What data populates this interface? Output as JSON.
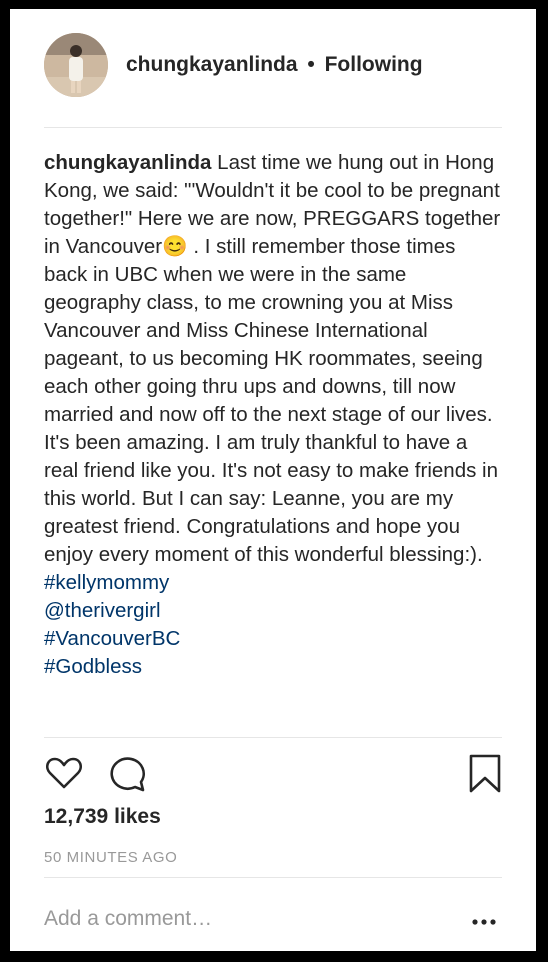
{
  "post": {
    "username": "chungkayanlinda",
    "separator": "•",
    "follow_status": "Following",
    "caption": {
      "user": "chungkayanlinda",
      "text": "Last time we hung out in Hong Kong, we said: \"'Wouldn't it be cool to be pregnant together!\" Here we are now, PREGGARS together in Vancouver😊 . I still remember those times back in UBC when we were in the same geography class, to me crowning you at Miss Vancouver and Miss Chinese International pageant, to us becoming HK roommates, seeing each other going thru ups and downs, till now married and now off to the next stage of our lives. It's been amazing. I am truly thankful to have a real friend like you. It's not easy to make friends in this world. But I can say: Leanne, you are my greatest friend. Congratulations and hope you enjoy every moment of this wonderful blessing:).",
      "hashtag1": "#kellymommy",
      "mention": "@therivergirl",
      "hashtag2": "#VancouverBC",
      "hashtag3": "#Godbless"
    },
    "likes": "12,739 likes",
    "time": "50 MINUTES AGO",
    "comment_placeholder": "Add a comment…",
    "icons": {
      "like": "heart-icon",
      "comment": "comment-bubble-icon",
      "save": "bookmark-icon",
      "more": "more-options-icon"
    },
    "colors": {
      "link": "#003569",
      "text": "#262626",
      "muted": "#999999"
    }
  }
}
